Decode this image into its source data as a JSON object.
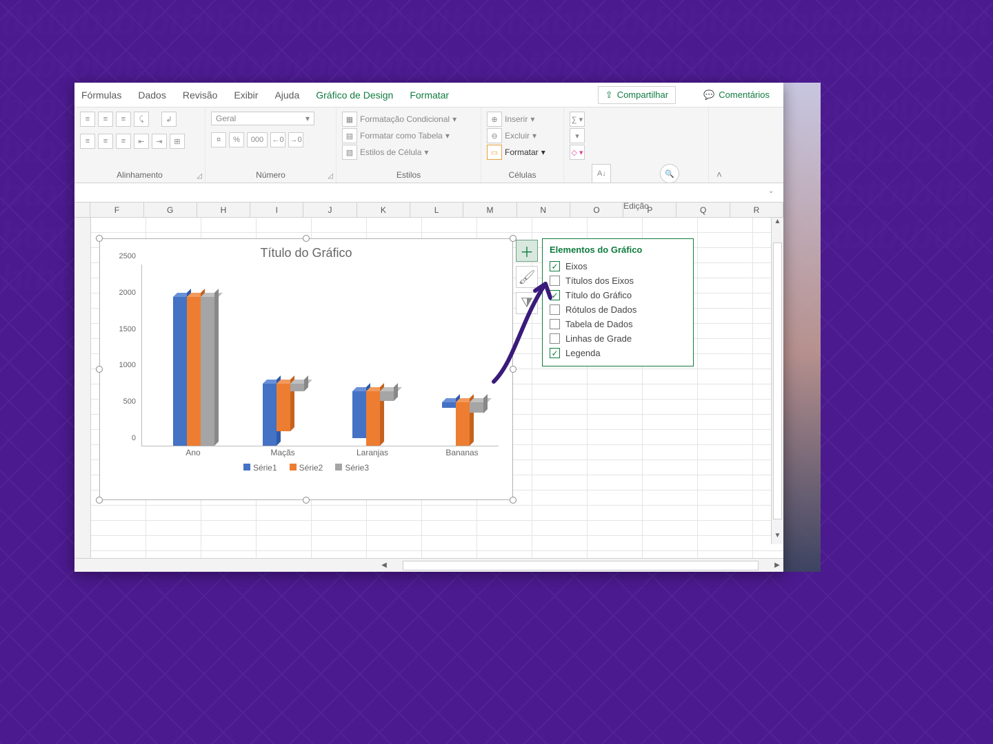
{
  "ribbon_tabs": {
    "formulas": "Fórmulas",
    "data": "Dados",
    "review": "Revisão",
    "view": "Exibir",
    "help": "Ajuda",
    "chart_design": "Gráfico de Design",
    "format": "Formatar"
  },
  "ribbon_actions": {
    "share": "Compartilhar",
    "comments": "Comentários"
  },
  "ribbon": {
    "alignment_label": "Alinhamento",
    "number_label": "Número",
    "number_format": "Geral",
    "styles_label": "Estilos",
    "styles": {
      "conditional": "Formatação Condicional",
      "table": "Formatar como Tabela",
      "cell": "Estilos de Célula"
    },
    "cells_label": "Células",
    "cells": {
      "insert": "Inserir",
      "delete": "Excluir",
      "format": "Formatar"
    },
    "editing_label": "Edição",
    "editing": {
      "sort": "Classificar e Filtrar",
      "find": "Localizar e Selecionar"
    }
  },
  "columns": [
    "F",
    "G",
    "H",
    "I",
    "J",
    "K",
    "L",
    "M",
    "N",
    "O",
    "P",
    "Q",
    "R"
  ],
  "chart": {
    "title": "Título do Gráfico",
    "legend": {
      "s1": "Série1",
      "s2": "Série2",
      "s3": "Série3"
    }
  },
  "chart_data": {
    "type": "bar",
    "categories": [
      "Ano",
      "Maçãs",
      "Laranjas",
      "Bananas"
    ],
    "series": [
      {
        "name": "Série1",
        "values": [
          2050,
          850,
          650,
          80
        ]
      },
      {
        "name": "Série2",
        "values": [
          2050,
          650,
          750,
          600
        ]
      },
      {
        "name": "Série3",
        "values": [
          2050,
          100,
          130,
          150
        ]
      }
    ],
    "ylim": [
      0,
      2500
    ],
    "yticks": [
      0,
      500,
      1000,
      1500,
      2000,
      2500
    ],
    "title": "Título do Gráfico",
    "xlabel": "",
    "ylabel": ""
  },
  "chart_elements_popup": {
    "title": "Elementos do Gráfico",
    "items": [
      {
        "label": "Eixos",
        "checked": true
      },
      {
        "label": "Títulos dos Eixos",
        "checked": false
      },
      {
        "label": "Título do Gráfico",
        "checked": true
      },
      {
        "label": "Rótulos de Dados",
        "checked": false
      },
      {
        "label": "Tabela de Dados",
        "checked": false
      },
      {
        "label": "Linhas de Grade",
        "checked": false
      },
      {
        "label": "Legenda",
        "checked": true
      }
    ]
  },
  "number_symbols": {
    "pct": "%",
    "thou": "000",
    "dec_inc": ",00",
    "dec_dec": ",00"
  }
}
